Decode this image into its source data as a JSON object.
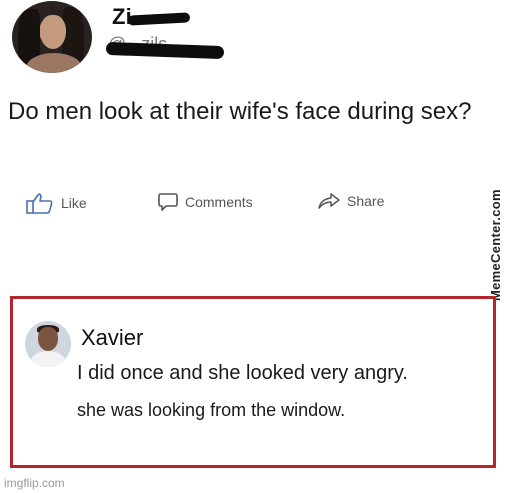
{
  "post": {
    "username": "Zi",
    "handle": "@...zils",
    "text": "Do men look at their wife's face during sex?"
  },
  "actions": {
    "like": {
      "label": "Like",
      "icon": "thumbs-up-icon"
    },
    "comment": {
      "label": "Comments",
      "icon": "speech-bubble-icon"
    },
    "share": {
      "label": "Share",
      "icon": "share-arrow-icon"
    }
  },
  "comment": {
    "name": "Xavier",
    "line1": "I did once and she looked very angry.",
    "line2": "she was looking from the window.",
    "highlight_color": "#b3262b"
  },
  "watermarks": {
    "side": "MemeCenter.com",
    "bottom": "imgflip.com"
  }
}
